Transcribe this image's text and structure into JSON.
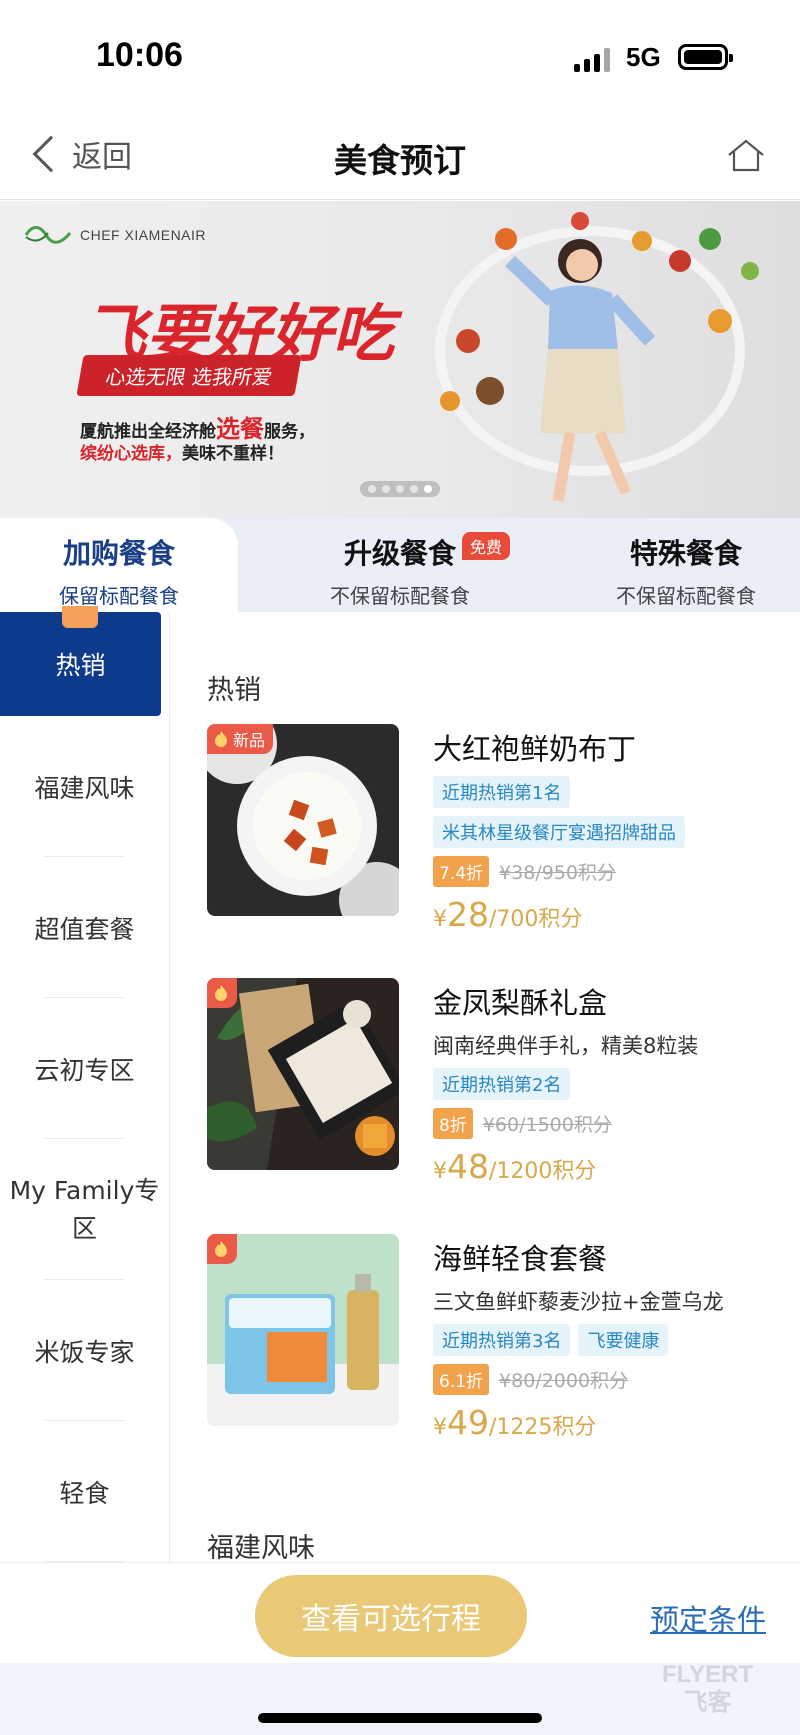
{
  "status_bar": {
    "time": "10:06",
    "network": "5G"
  },
  "nav": {
    "back_label": "返回",
    "title": "美食预订"
  },
  "banner": {
    "brand": "CHEF XIAMENAIR",
    "headline": "飞要好好吃",
    "slogan": "心选无限 选我所爱",
    "desc_line1_pre": "厦航推出全经济舱",
    "desc_line1_hl": "选餐",
    "desc_line1_post": "服务，",
    "desc_line2_hl": "缤纷心选库，",
    "desc_line2_post": "美味不重样！",
    "page_count": 5,
    "active_page": 4
  },
  "tabs": [
    {
      "title": "加购餐食",
      "sub": "保留标配餐食",
      "active": true
    },
    {
      "title": "升级餐食",
      "sub": "不保留标配餐食",
      "badge": "免费"
    },
    {
      "title": "特殊餐食",
      "sub": "不保留标配餐食"
    }
  ],
  "sidebar": [
    {
      "label": "热销",
      "active": true
    },
    {
      "label": "福建风味"
    },
    {
      "label": "超值套餐"
    },
    {
      "label": "云初专区"
    },
    {
      "label": "My Family专区"
    },
    {
      "label": "米饭专家"
    },
    {
      "label": "轻食"
    }
  ],
  "content": {
    "section_hot": "热销",
    "section_next": "福建风味",
    "products": [
      {
        "badge": "新品",
        "name": "大红袍鲜奶布丁",
        "sub": "",
        "tags": [
          "近期热销第1名",
          "米其林星级餐厅宴遇招牌甜品"
        ],
        "discount": "7.4折",
        "original": "¥38/950积分",
        "price_yen": "¥",
        "price": "28",
        "price_points": "/700积分"
      },
      {
        "badge": "",
        "name": "金凤梨酥礼盒",
        "sub": "闽南经典伴手礼，精美8粒装",
        "tags": [
          "近期热销第2名"
        ],
        "discount": "8折",
        "original": "¥60/1500积分",
        "price_yen": "¥",
        "price": "48",
        "price_points": "/1200积分"
      },
      {
        "badge": "",
        "name": "海鲜轻食套餐",
        "sub": "三文鱼鲜虾藜麦沙拉+金萱乌龙",
        "tags": [
          "近期热销第3名",
          "飞要健康"
        ],
        "discount": "6.1折",
        "original": "¥80/2000积分",
        "price_yen": "¥",
        "price": "49",
        "price_points": "/1225积分"
      }
    ]
  },
  "bottom": {
    "cta": "查看可选行程",
    "conditions": "预定条件",
    "watermark_en": "FLYERT",
    "watermark_cn": "飞客"
  },
  "colors": {
    "primary_blue": "#0e3a8c",
    "gold": "#e9c978",
    "price_gold": "#d7a94b",
    "tag_blue": "#2a88c5",
    "discount_orange": "#f2a24a",
    "hot_red": "#ea5a47"
  }
}
